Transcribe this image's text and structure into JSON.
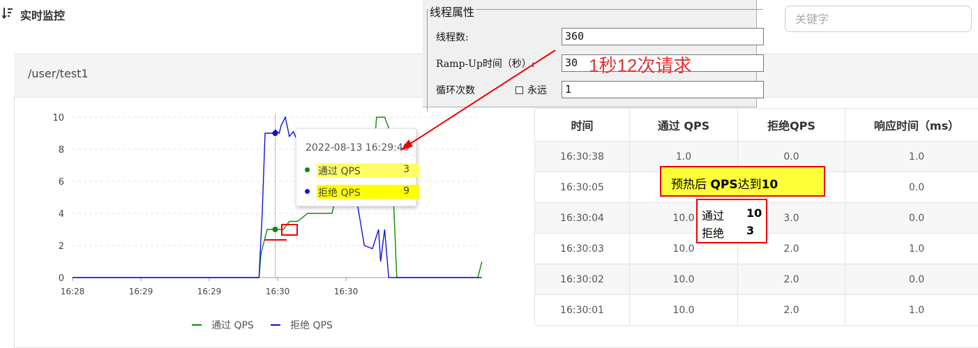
{
  "header": {
    "title": "实时监控",
    "filter_icon": "sort-filter-icon"
  },
  "search": {
    "placeholder": "关键字"
  },
  "panel": {
    "title": "/user/test1"
  },
  "chart_data": {
    "type": "line",
    "x_ticks": [
      "16:28",
      "16:29",
      "16:29",
      "16:30",
      "16:30"
    ],
    "ylim": [
      0,
      10
    ],
    "y_ticks": [
      0,
      2,
      4,
      6,
      8,
      10
    ],
    "legend_position": "bottom",
    "series": [
      {
        "name": "通过 QPS",
        "color": "#0a8a0a",
        "x": [
          0,
          0.46,
          0.46,
          0.465,
          0.48,
          0.5,
          0.51,
          0.52,
          0.535,
          0.555,
          0.58,
          0.6,
          0.64,
          0.66,
          0.67,
          0.73,
          0.74,
          0.75,
          0.75,
          0.77,
          0.785,
          0.8,
          1.0,
          1.01
        ],
        "y": [
          0,
          0,
          0,
          1.5,
          3,
          3,
          3,
          3,
          3.5,
          3.5,
          4,
          4,
          4,
          6,
          6,
          6,
          6.5,
          10,
          10,
          10,
          9,
          0,
          0,
          1
        ]
      },
      {
        "name": "拒绝 QPS",
        "color": "#1010e0",
        "x": [
          0,
          0.46,
          0.46,
          0.468,
          0.475,
          0.5,
          0.5,
          0.51,
          0.515,
          0.525,
          0.535,
          0.545,
          0.555,
          0.57,
          0.6,
          0.62,
          0.64,
          0.66,
          0.7,
          0.72,
          0.74,
          0.755,
          0.76,
          0.77,
          0.78,
          0.8,
          1.01
        ],
        "y": [
          0,
          0,
          0,
          4,
          9,
          9,
          9.2,
          9,
          9.5,
          10,
          8.8,
          9.1,
          8.5,
          8.6,
          8.4,
          6,
          4.6,
          6,
          5,
          2,
          1.8,
          3,
          1,
          3,
          0,
          0,
          0
        ]
      }
    ],
    "cursor": {
      "x": 0.5,
      "label": "2022-08-13 16:29:40"
    }
  },
  "tooltip": {
    "time": "2022-08-13 16:29:40",
    "rows": [
      {
        "name": "通过 QPS",
        "value": "3",
        "color": "#0a8a0a"
      },
      {
        "name": "拒绝 QPS",
        "value": "9",
        "color": "#1010e0"
      }
    ]
  },
  "table": {
    "headers": [
      "时间",
      "通过 QPS",
      "拒绝QPS",
      "响应时间（ms）"
    ],
    "rows": [
      [
        "16:30:38",
        "1.0",
        "0.0",
        "1.0"
      ],
      [
        "16:30:05",
        "",
        "",
        "0.0"
      ],
      [
        "16:30:04",
        "10.0",
        "3.0",
        "0.0"
      ],
      [
        "16:30:03",
        "10.0",
        "2.0",
        "1.0"
      ],
      [
        "16:30:02",
        "10.0",
        "2.0",
        "0.0"
      ],
      [
        "16:30:01",
        "10.0",
        "2.0",
        "1.0"
      ]
    ]
  },
  "jmeter": {
    "group_title": "线程属性",
    "threads_label": "线程数:",
    "threads_value": "360",
    "rampup_label": "Ramp-Up时间（秒）:",
    "rampup_value": "30",
    "loop_label": "循环次数",
    "forever_label": "永远",
    "loop_value": "1"
  },
  "annotations": {
    "rate": "1秒12次请求",
    "warmup_prefix": "预热后 ",
    "warmup_bold": "QPS",
    "warmup_mid": "达到",
    "warmup_num": "10",
    "pass_label": "通过",
    "pass_value": "10",
    "reject_label": "拒绝",
    "reject_value": "3",
    "red_color": "#e00000"
  }
}
